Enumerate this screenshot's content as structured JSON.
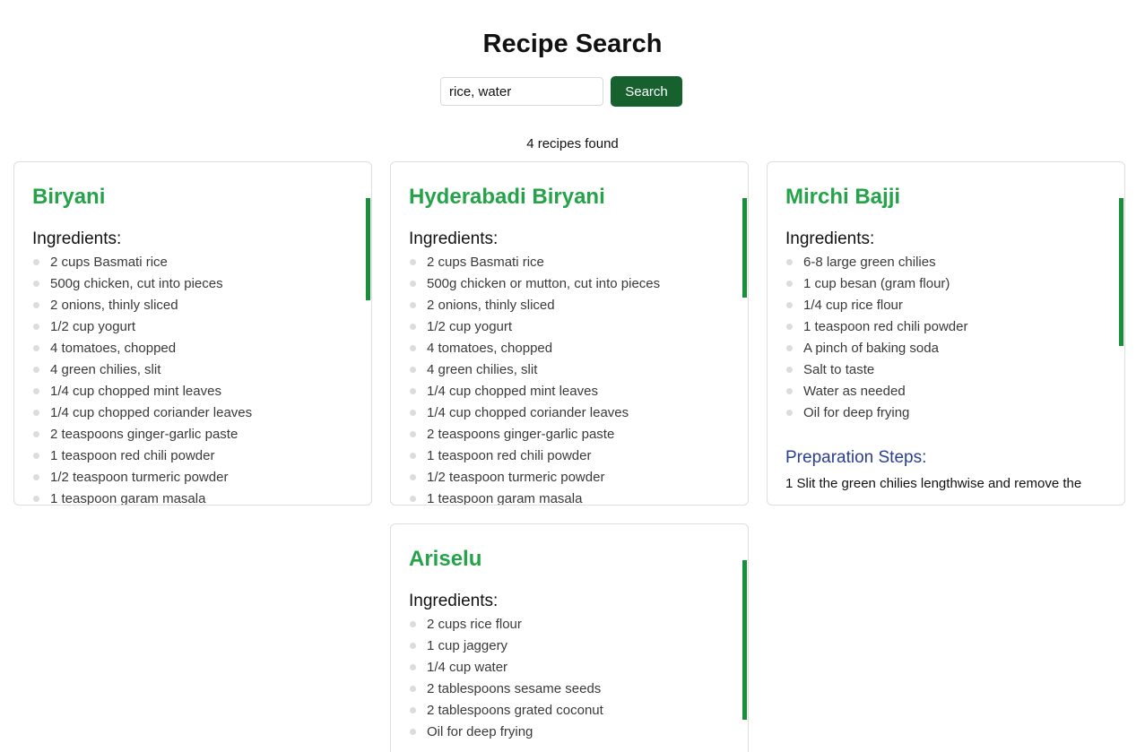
{
  "header": {
    "title": "Recipe Search"
  },
  "search": {
    "value": "rice, water",
    "button_label": "Search"
  },
  "results": {
    "count_text": "4 recipes found"
  },
  "colors": {
    "accent_green": "#17612f",
    "title_green": "#25a349",
    "scroll_green": "#16913a",
    "steps_blue": "#2c3e93"
  },
  "recipes": [
    {
      "title": "Biryani",
      "ingredients_heading": "Ingredients:",
      "ingredients": [
        "2 cups Basmati rice",
        "500g chicken, cut into pieces",
        "2 onions, thinly sliced",
        "1/2 cup yogurt",
        "4 tomatoes, chopped",
        "4 green chilies, slit",
        "1/4 cup chopped mint leaves",
        "1/4 cup chopped coriander leaves",
        "2 teaspoons ginger-garlic paste",
        "1 teaspoon red chili powder",
        "1/2 teaspoon turmeric powder",
        "1 teaspoon garam masala"
      ]
    },
    {
      "title": "Hyderabadi Biryani",
      "ingredients_heading": "Ingredients:",
      "ingredients": [
        "2 cups Basmati rice",
        "500g chicken or mutton, cut into pieces",
        "2 onions, thinly sliced",
        "1/2 cup yogurt",
        "4 tomatoes, chopped",
        "4 green chilies, slit",
        "1/4 cup chopped mint leaves",
        "1/4 cup chopped coriander leaves",
        "2 teaspoons ginger-garlic paste",
        "1 teaspoon red chili powder",
        "1/2 teaspoon turmeric powder",
        "1 teaspoon garam masala"
      ]
    },
    {
      "title": "Mirchi Bajji",
      "ingredients_heading": "Ingredients:",
      "ingredients": [
        "6-8 large green chilies",
        "1 cup besan (gram flour)",
        "1/4 cup rice flour",
        "1 teaspoon red chili powder",
        "A pinch of baking soda",
        "Salt to taste",
        "Water as needed",
        "Oil for deep frying"
      ],
      "steps_heading": "Preparation Steps:",
      "step_1": "1 Slit the green chilies lengthwise and remove the"
    },
    {
      "title": "Ariselu",
      "ingredients_heading": "Ingredients:",
      "ingredients": [
        "2 cups rice flour",
        "1 cup jaggery",
        "1/4 cup water",
        "2 tablespoons sesame seeds",
        "2 tablespoons grated coconut",
        "Oil for deep frying"
      ]
    }
  ]
}
